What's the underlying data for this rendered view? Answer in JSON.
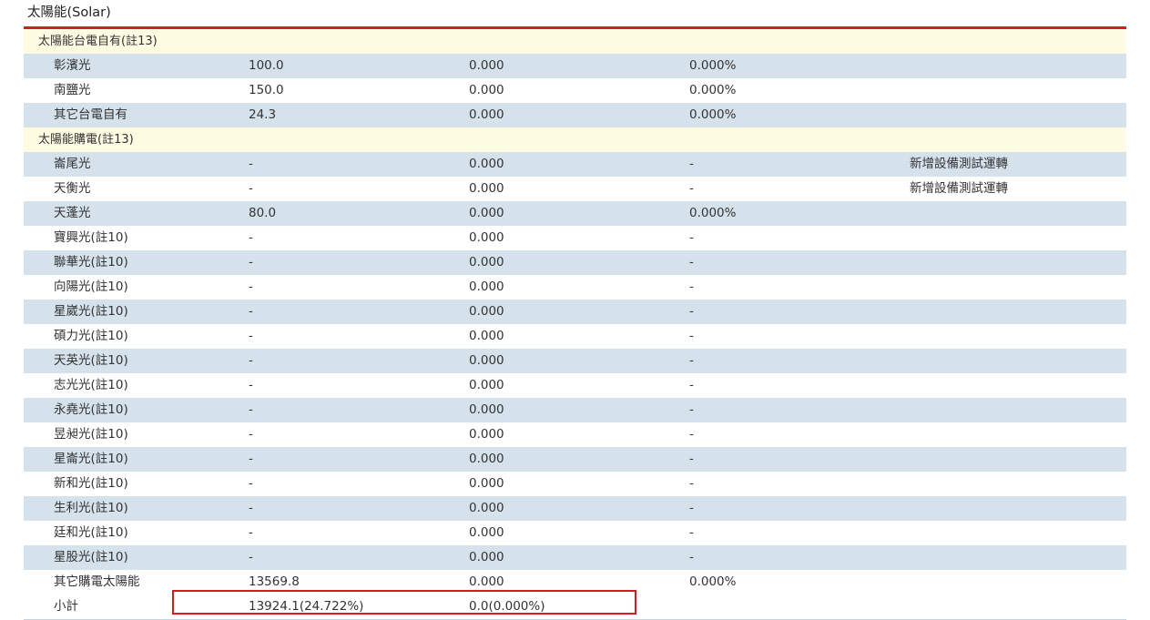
{
  "section": {
    "title": "太陽能(Solar)"
  },
  "groups": [
    {
      "label": "太陽能台電自有(註13)",
      "rows": [
        {
          "name": "彰濱光",
          "capacity": "100.0",
          "generation": "0.000",
          "percent": "0.000%",
          "note": ""
        },
        {
          "name": "南鹽光",
          "capacity": "150.0",
          "generation": "0.000",
          "percent": "0.000%",
          "note": ""
        },
        {
          "name": "其它台電自有",
          "capacity": "24.3",
          "generation": "0.000",
          "percent": "0.000%",
          "note": ""
        }
      ]
    },
    {
      "label": "太陽能購電(註13)",
      "rows": [
        {
          "name": "崙尾光",
          "capacity": "-",
          "generation": "0.000",
          "percent": "-",
          "note": "新增設備測試運轉"
        },
        {
          "name": "天衡光",
          "capacity": "-",
          "generation": "0.000",
          "percent": "-",
          "note": "新增設備測試運轉"
        },
        {
          "name": "天蓬光",
          "capacity": "80.0",
          "generation": "0.000",
          "percent": "0.000%",
          "note": ""
        },
        {
          "name": "寶興光(註10)",
          "capacity": "-",
          "generation": "0.000",
          "percent": "-",
          "note": ""
        },
        {
          "name": "聯華光(註10)",
          "capacity": "-",
          "generation": "0.000",
          "percent": "-",
          "note": ""
        },
        {
          "name": "向陽光(註10)",
          "capacity": "-",
          "generation": "0.000",
          "percent": "-",
          "note": ""
        },
        {
          "name": "星崴光(註10)",
          "capacity": "-",
          "generation": "0.000",
          "percent": "-",
          "note": ""
        },
        {
          "name": "碩力光(註10)",
          "capacity": "-",
          "generation": "0.000",
          "percent": "-",
          "note": ""
        },
        {
          "name": "天英光(註10)",
          "capacity": "-",
          "generation": "0.000",
          "percent": "-",
          "note": ""
        },
        {
          "name": "志光光(註10)",
          "capacity": "-",
          "generation": "0.000",
          "percent": "-",
          "note": ""
        },
        {
          "name": "永堯光(註10)",
          "capacity": "-",
          "generation": "0.000",
          "percent": "-",
          "note": ""
        },
        {
          "name": "昱昶光(註10)",
          "capacity": "-",
          "generation": "0.000",
          "percent": "-",
          "note": ""
        },
        {
          "name": "星崙光(註10)",
          "capacity": "-",
          "generation": "0.000",
          "percent": "-",
          "note": ""
        },
        {
          "name": "新和光(註10)",
          "capacity": "-",
          "generation": "0.000",
          "percent": "-",
          "note": ""
        },
        {
          "name": "生利光(註10)",
          "capacity": "-",
          "generation": "0.000",
          "percent": "-",
          "note": ""
        },
        {
          "name": "廷和光(註10)",
          "capacity": "-",
          "generation": "0.000",
          "percent": "-",
          "note": ""
        },
        {
          "name": "星股光(註10)",
          "capacity": "-",
          "generation": "0.000",
          "percent": "-",
          "note": ""
        },
        {
          "name": "其它購電太陽能",
          "capacity": "13569.8",
          "generation": "0.000",
          "percent": "0.000%",
          "note": ""
        }
      ]
    }
  ],
  "subtotal": {
    "name": "小計",
    "capacity": "13924.1(24.722%)",
    "generation": "0.0(0.000%)"
  },
  "colors": {
    "accent_red": "#d81b1b",
    "row_alt": "#d5e2ec",
    "group_bg": "#fefbe3"
  }
}
